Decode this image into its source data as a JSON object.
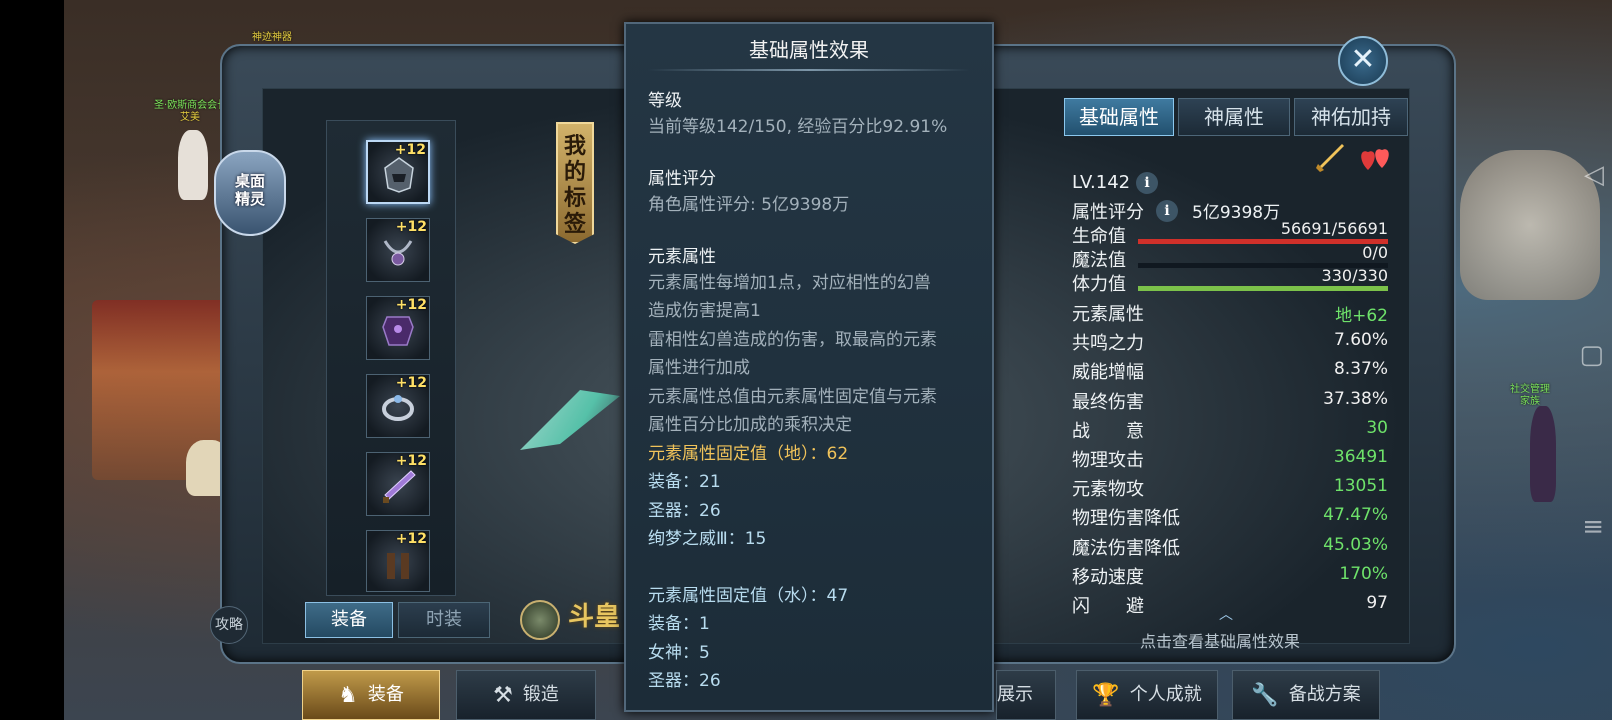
{
  "world": {
    "npc_top": "神迹神器",
    "npc_left_name": "圣·欧斯商会会长",
    "npc_left_sub": "艾美",
    "npc_right_name": "社交管理",
    "npc_right_sub": "家族"
  },
  "sidebar": {
    "elf_label_line1": "桌面",
    "elf_label_line2": "精灵",
    "guide_label": "攻略"
  },
  "equipment": {
    "slots": [
      {
        "level": "+12"
      },
      {
        "level": "+12"
      },
      {
        "level": "+12"
      },
      {
        "level": "+12"
      },
      {
        "level": "+12"
      },
      {
        "level": "+12"
      }
    ],
    "tag_banner": "我的标签",
    "tab_equip": "装备",
    "tab_fashion": "时装",
    "logo_text": "斗皇"
  },
  "tooltip": {
    "title": "基础属性效果",
    "level_head": "等级",
    "level_body": "当前等级142/150, 经验百分比92.91%",
    "score_head": "属性评分",
    "score_body": "角色属性评分: 5亿9398万",
    "element_head": "元素属性",
    "element_line1": "元素属性每增加1点，对应相性的幻兽",
    "element_line2": "造成伤害提高1",
    "element_line3": "雷相性幻兽造成的伤害，取最高的元素",
    "element_line4": "属性进行加成",
    "element_line5": "元素属性总值由元素属性固定值与元素",
    "element_line6": "属性百分比加成的乘积决定",
    "earth_fixed": "元素属性固定值（地）：62",
    "earth_equip": "装备：21",
    "earth_holy": "圣器：26",
    "earth_dream": "绚梦之威Ⅲ：15",
    "water_fixed": "元素属性固定值（水）：47",
    "water_equip": "装备：1",
    "water_goddess": "女神：5",
    "water_holy": "圣器：26"
  },
  "stats_panel": {
    "tabs": [
      "基础属性",
      "神属性",
      "神佑加持"
    ],
    "level": "LV.142",
    "score_label": "属性评分",
    "score_value": "5亿9398万",
    "hp_label": "生命值",
    "hp_value": "56691/56691",
    "hp_fraction": 1.0,
    "mp_label": "魔法值",
    "mp_value": "0/0",
    "mp_fraction": 0,
    "stamina_label": "体力值",
    "stamina_value": "330/330",
    "stamina_fraction": 1.0,
    "rows": [
      {
        "label": "元素属性",
        "value": "地+62",
        "color": "green"
      },
      {
        "label": "共鸣之力",
        "value": "7.60%",
        "color": "white"
      },
      {
        "label": "威能增幅",
        "value": "8.37%",
        "color": "white"
      },
      {
        "label": "最终伤害",
        "value": "37.38%",
        "color": "white"
      },
      {
        "label": "战　　意",
        "value": "30",
        "color": "green"
      },
      {
        "label": "物理攻击",
        "value": "36491",
        "color": "green"
      },
      {
        "label": "元素物攻",
        "value": "13051",
        "color": "green"
      },
      {
        "label": "物理伤害降低",
        "value": "47.47%",
        "color": "green"
      },
      {
        "label": "魔法伤害降低",
        "value": "45.03%",
        "color": "green"
      },
      {
        "label": "移动速度",
        "value": "170%",
        "color": "green"
      },
      {
        "label": "闪　　避",
        "value": "97",
        "color": "white"
      }
    ],
    "hint": "点击查看基础属性效果"
  },
  "bottom_bar": {
    "equip": "装备",
    "forge": "锻造",
    "display": "展示",
    "achievements": "个人成就",
    "battle_plan": "备战方案"
  },
  "colors": {
    "hp_bar": "#d0302a",
    "stamina_bar": "#7cc24a",
    "gold_text": "#f0c35a",
    "green_value": "#6ee26a"
  }
}
